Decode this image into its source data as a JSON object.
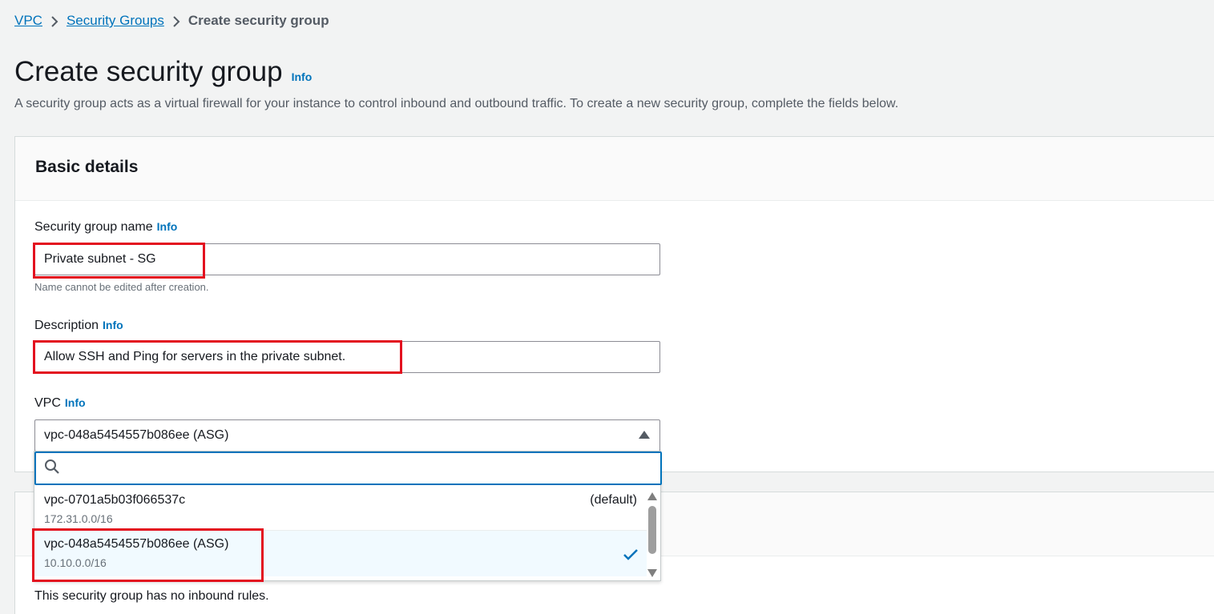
{
  "breadcrumb": {
    "items": [
      "VPC",
      "Security Groups"
    ],
    "current": "Create security group"
  },
  "page": {
    "title": "Create security group",
    "info": "Info",
    "description": "A security group acts as a virtual firewall for your instance to control inbound and outbound traffic. To create a new security group, complete the fields below."
  },
  "basic_details": {
    "heading": "Basic details",
    "name_label": "Security group name",
    "name_info": "Info",
    "name_value": "Private subnet - SG",
    "name_hint": "Name cannot be edited after creation.",
    "description_label": "Description",
    "description_info": "Info",
    "description_value": "Allow SSH and Ping for servers in the private subnet.",
    "vpc_label": "VPC",
    "vpc_info": "Info",
    "vpc_selected": "vpc-048a5454557b086ee (ASG)"
  },
  "vpc_dropdown": {
    "search_value": "",
    "options": [
      {
        "id": "vpc-0701a5b03f066537c",
        "tag": "(default)",
        "cidr": "172.31.0.0/16",
        "selected": false
      },
      {
        "id": "vpc-048a5454557b086ee (ASG)",
        "tag": "",
        "cidr": "10.10.0.0/16",
        "selected": true
      }
    ]
  },
  "inbound": {
    "empty_text": "This security group has no inbound rules."
  },
  "colors": {
    "link": "#0073bb",
    "highlight": "#e3101f",
    "selected_bg": "#f1faff"
  }
}
